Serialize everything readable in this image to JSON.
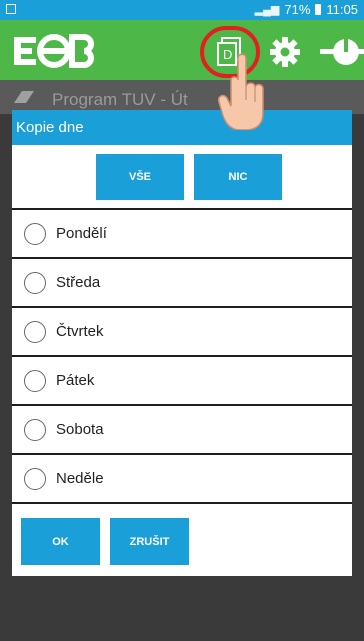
{
  "statusbar": {
    "signal": "‧‧▙",
    "battery": "71%",
    "time": "11:05"
  },
  "appbar": {
    "icons": [
      "logo",
      "copy-day-icon",
      "gear-icon",
      "power-icon"
    ],
    "copy_icon_letter": "D"
  },
  "background_header": {
    "title": "Program TUV - Út"
  },
  "dialog": {
    "title": "Kopie dne",
    "select_all_label": "VŠE",
    "select_none_label": "NIC",
    "days": [
      {
        "label": "Pondělí",
        "checked": false
      },
      {
        "label": "Středa",
        "checked": false
      },
      {
        "label": "Čtvrtek",
        "checked": false
      },
      {
        "label": "Pátek",
        "checked": false
      },
      {
        "label": "Sobota",
        "checked": false
      },
      {
        "label": "Neděle",
        "checked": false
      }
    ],
    "ok_label": "OK",
    "cancel_label": "ZRUŠIT"
  },
  "colors": {
    "accent": "#1a9fd9",
    "appbar": "#4db848",
    "highlight": "#e32020",
    "dim_background": "#3a3a3a"
  }
}
